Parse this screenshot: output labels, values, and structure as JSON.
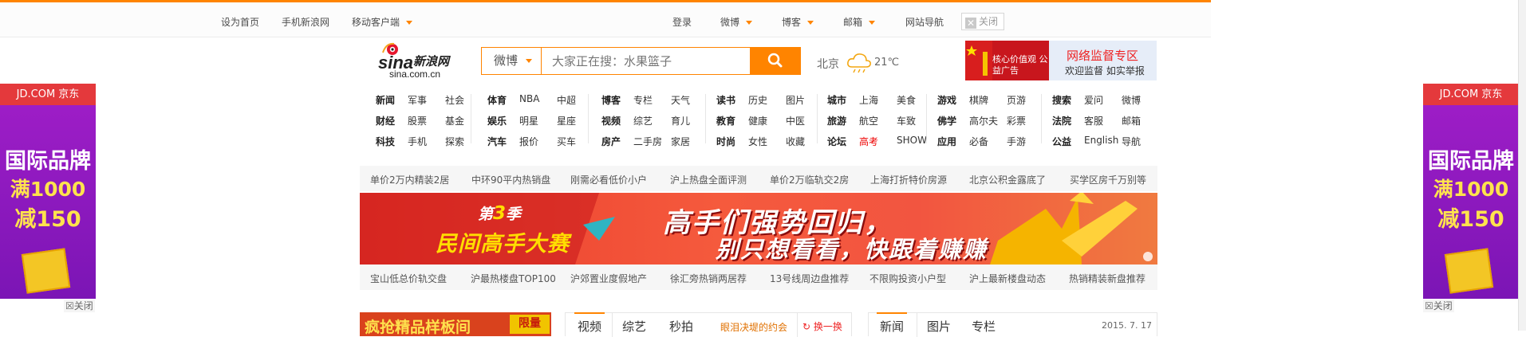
{
  "topbar": {
    "set_home": "设为首页",
    "mobile_sina": "手机新浪网",
    "mobile_client": "移动客户端",
    "login": "登录",
    "weibo": "微博",
    "blog": "博客",
    "mail": "邮箱",
    "site_nav": "网站导航",
    "close": "关闭"
  },
  "logo": {
    "main": "新浪网",
    "sub": "sina.com.cn"
  },
  "search": {
    "select": "微博",
    "placeholder": "大家正在搜：水果篮子"
  },
  "weather": {
    "city": "北京",
    "temp": "21℃"
  },
  "ads": {
    "core_value": "核心价值观 公益广告",
    "net_supervise_title": "网络监督专区",
    "net_supervise_sub": "欢迎监督 如实举报",
    "jd_brand": "JD.COM 京东",
    "jd_l1": "国际品牌",
    "jd_l2": "满1000",
    "jd_l3": "减150",
    "close": "关闭"
  },
  "nav": {
    "g1": [
      [
        "新闻",
        "军事",
        "社会"
      ],
      [
        "财经",
        "股票",
        "基金"
      ],
      [
        "科技",
        "手机",
        "探索"
      ]
    ],
    "g2": [
      [
        "体育",
        "NBA",
        "中超"
      ],
      [
        "娱乐",
        "明星",
        "星座"
      ],
      [
        "汽车",
        "报价",
        "买车"
      ]
    ],
    "g3": [
      [
        "博客",
        "专栏",
        "天气"
      ],
      [
        "视频",
        "综艺",
        "育儿"
      ],
      [
        "房产",
        "二手房",
        "家居"
      ]
    ],
    "g4": [
      [
        "读书",
        "历史",
        "图片"
      ],
      [
        "教育",
        "健康",
        "中医"
      ],
      [
        "时尚",
        "女性",
        "收藏"
      ]
    ],
    "g5": [
      [
        "城市",
        "上海",
        "美食"
      ],
      [
        "旅游",
        "航空",
        "车致"
      ],
      [
        "论坛",
        "高考",
        "SHOW"
      ]
    ],
    "g6": [
      [
        "游戏",
        "棋牌",
        "页游"
      ],
      [
        "佛学",
        "高尔夫",
        "彩票"
      ],
      [
        "应用",
        "必备",
        "手游"
      ]
    ],
    "g7": [
      [
        "搜索",
        "爱问",
        "微博"
      ],
      [
        "法院",
        "客服",
        "邮箱"
      ],
      [
        "公益",
        "English",
        "导航"
      ]
    ]
  },
  "strip1": [
    "单价2万内精装2居",
    "中环90平内热销盘",
    "刚需必看低价小户",
    "沪上热盘全面评测",
    "单价2万临轨交2房",
    "上海打折特价房源",
    "北京公积金露底了",
    "买学区房千万别等"
  ],
  "strip2": [
    "宝山低总价轨交盘",
    "沪最热楼盘TOP100",
    "沪郊置业度假地产",
    "徐汇旁热销两居荐",
    "13号线周边盘推荐",
    "不限购投资小户型",
    "沪上最新楼盘动态",
    "热销精装新盘推荐"
  ],
  "banner": {
    "season_pre": "第",
    "season_num": "3",
    "season_post": "季",
    "contest": "民间高手大赛",
    "line1": "高手们强势回归，",
    "line2": "别只想看看，快跟着赚赚"
  },
  "bottom": {
    "ad_text": "疯抢精品样板间",
    "ad_tag": "限量",
    "video_tabs": [
      "视频",
      "综艺",
      "秒拍"
    ],
    "video_promo": "眼泪决堤的约会",
    "refresh": "换一换",
    "news_tabs": [
      "新闻",
      "图片",
      "专栏"
    ],
    "date": "2015. 7. 17"
  },
  "colors": {
    "accent": "#ff8400",
    "brand_red": "#e22",
    "banner_red": "#e93a2a"
  }
}
